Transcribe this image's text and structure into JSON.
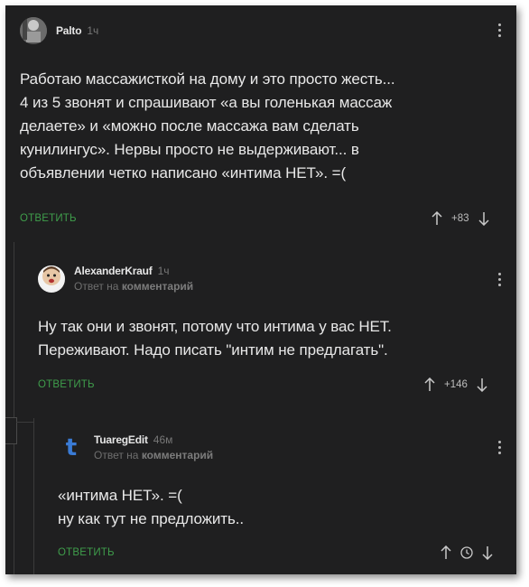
{
  "comments": [
    {
      "username": "Palto",
      "time": "1ч",
      "subline": null,
      "text_lines": [
        "Работаю массажисткой на дому и это просто жесть...",
        "4 из 5 звонят и спрашивают «а вы голенькая массаж",
        "делаете» и «можно после массажа вам сделать",
        "кунилингус». Нервы просто не выдерживают... в",
        "объявлении четко написано «интима НЕТ». =("
      ],
      "reply_label": "ОТВЕТИТЬ",
      "rating": "+83",
      "avatar_icon": "user-avatar-photo"
    },
    {
      "username": "AlexanderKrauf",
      "time": "1ч",
      "subline_prefix": "Ответ на",
      "subline_link": "комментарий",
      "text_lines": [
        "Ну так они и звонят, потому что интима у вас НЕТ.",
        "Переживают. Надо писать \"интим не предлагать\"."
      ],
      "reply_label": "ОТВЕТИТЬ",
      "rating": "+146",
      "avatar_icon": "user-avatar-cartoon"
    },
    {
      "username": "TuaregEdit",
      "time": "46м",
      "subline_prefix": "Ответ на",
      "subline_link": "комментарий",
      "text_lines": [
        "«интима НЕТ». =(",
        "ну как тут не предложить.."
      ],
      "reply_label": "ОТВЕТИТЬ",
      "rating": null,
      "avatar_icon": "user-avatar-letter-t",
      "avatar_letter": "t"
    }
  ],
  "colors": {
    "background": "#1f1f20",
    "reply_green": "#3f9d4b",
    "text": "#e8e8e8",
    "muted": "#777777",
    "avatar_t_blue": "#3a7bd5"
  }
}
